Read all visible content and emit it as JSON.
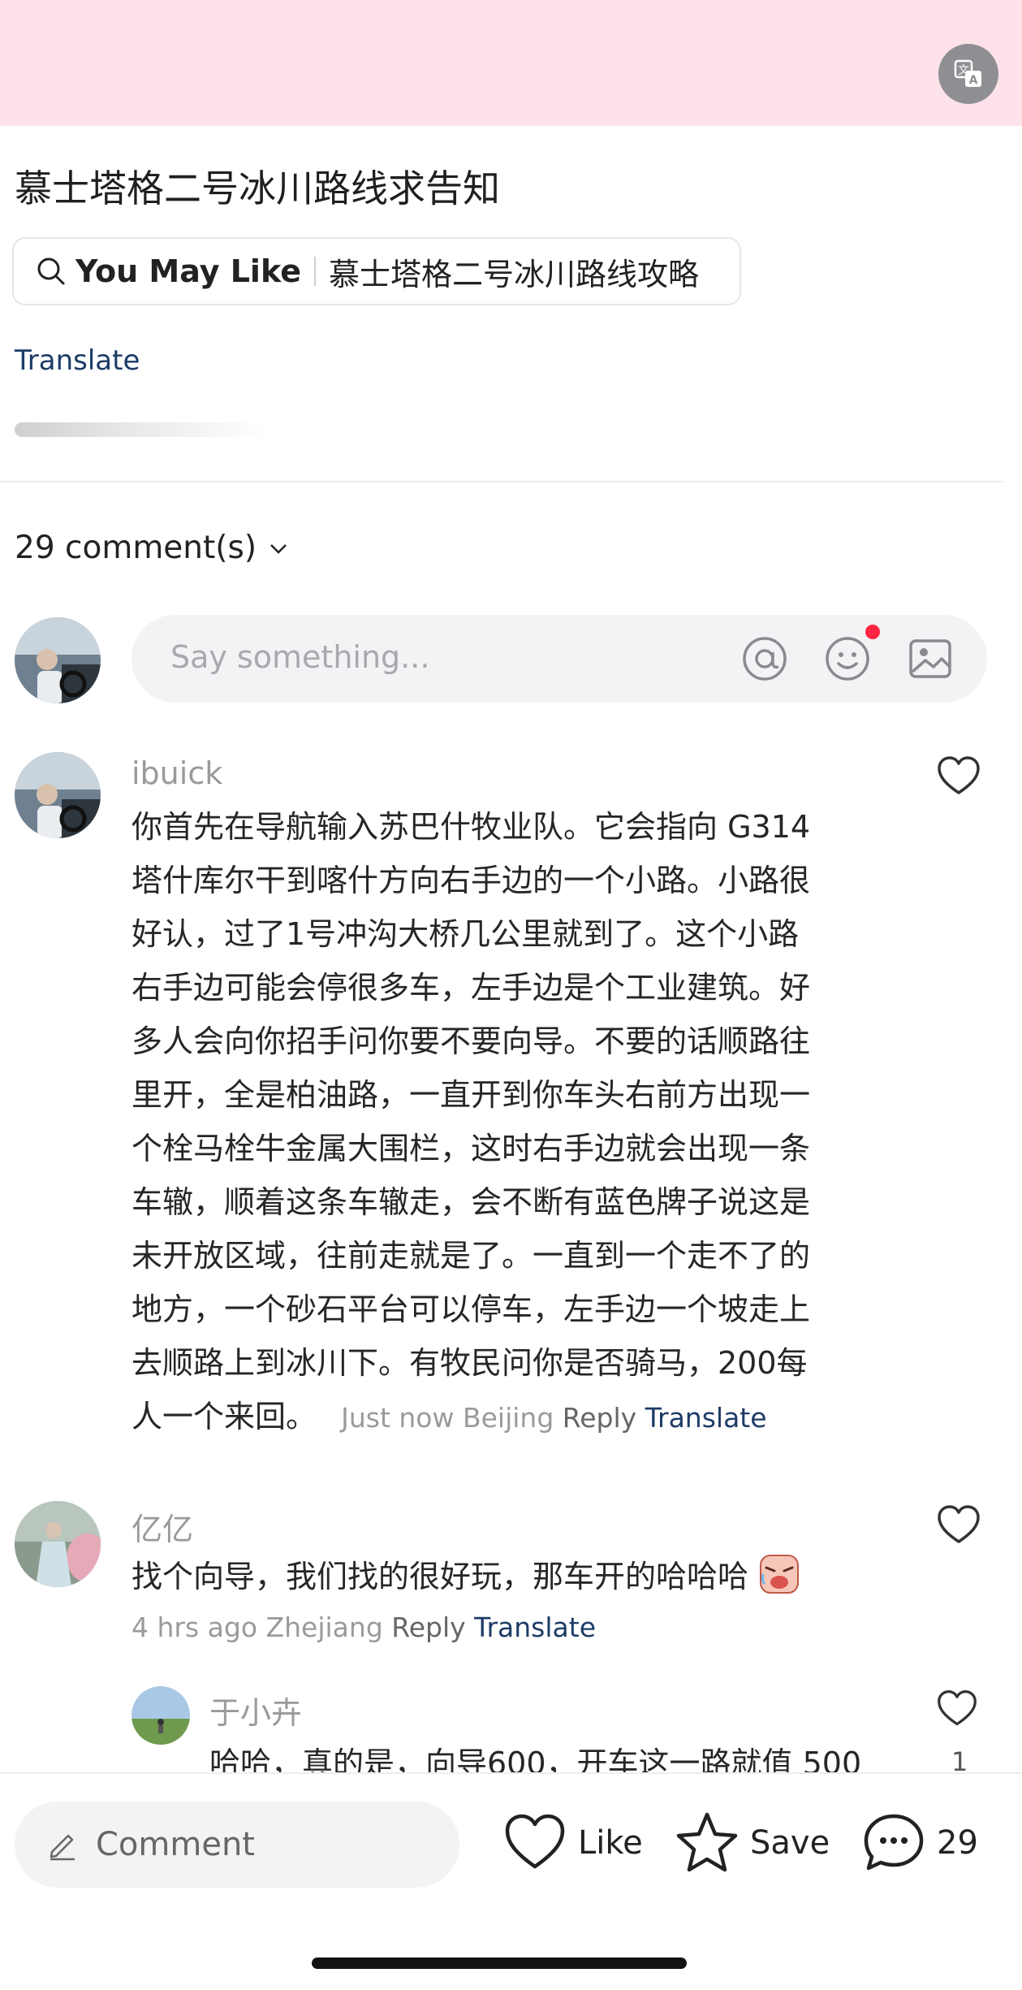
{
  "post": {
    "title": "慕士塔格二号冰川路线求告知",
    "you_may_like_label": "You May Like",
    "you_may_like_query": "慕士塔格二号冰川路线攻略",
    "translate_label": "Translate"
  },
  "comments_header": {
    "count_label": "29 comment(s)"
  },
  "composer": {
    "placeholder": "Say something...",
    "icons": [
      "at-icon",
      "emoji-icon",
      "image-icon"
    ]
  },
  "comments": [
    {
      "user": "ibuick",
      "text_lines": [
        "你首先在导航输入苏巴什牧业队。它会指向 G314",
        "塔什库尔干到喀什方向右手边的一个小路。小路很",
        "好认，过了1号冲沟大桥几公里就到了。这个小路",
        "右手边可能会停很多车，左手边是个工业建筑。好",
        "多人会向你招手问你要不要向导。不要的话顺路往",
        "里开，全是柏油路，一直开到你车头右前方出现一",
        "个栓马栓牛金属大围栏，这时右手边就会出现一条",
        "车辙，顺着这条车辙走，会不断有蓝色牌子说这是",
        "未开放区域，往前走就是了。一直到一个走不了的",
        "地方，一个砂石平台可以停车，左手边一个坡走上",
        "去顺路上到冰川下。有牧民问你是否骑马，200每",
        "人一个来回。"
      ],
      "time": "Just now",
      "location": "Beijing",
      "reply_label": "Reply",
      "translate_label": "Translate"
    },
    {
      "user": "亿亿",
      "text": "找个向导，我们找的很好玩，那车开的哈哈哈",
      "emoji": "laughing-crying-face",
      "time": "4 hrs ago",
      "location": "Zhejiang",
      "reply_label": "Reply",
      "translate_label": "Translate",
      "replies": [
        {
          "user": "于小卉",
          "text": "哈哈，真的是，向导600，开车这一路就值 500",
          "likes": "1"
        }
      ]
    }
  ],
  "bottom_bar": {
    "comment_label": "Comment",
    "like_label": "Like",
    "save_label": "Save",
    "comment_count": "29"
  },
  "colors": {
    "top_banner": "#fde2ea",
    "link_blue": "#1d3b66",
    "notification_red": "#ff2442"
  }
}
